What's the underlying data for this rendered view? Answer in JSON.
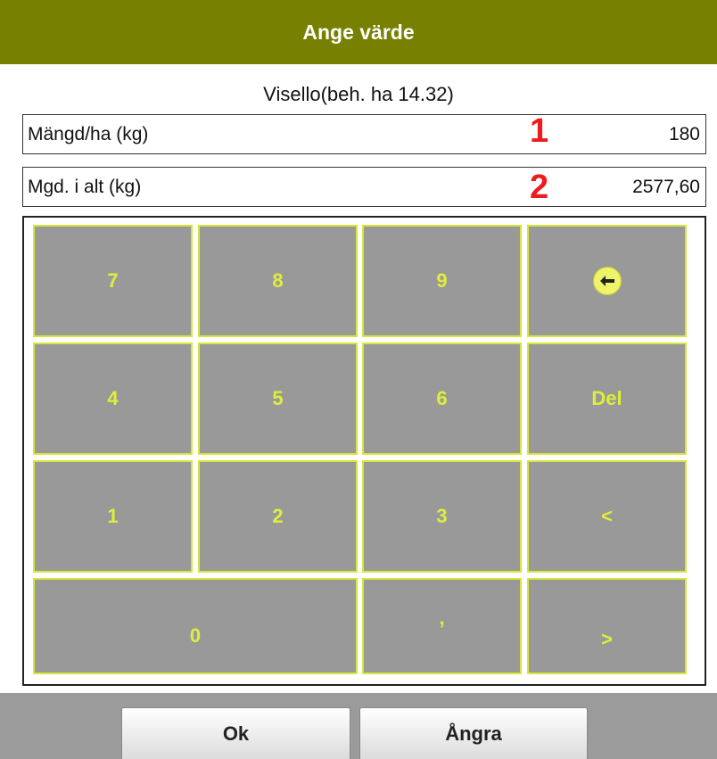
{
  "header": {
    "title": "Ange värde"
  },
  "subtitle": "Visello(beh. ha 14.32)",
  "fields": [
    {
      "label": "Mängd/ha (kg)",
      "value": "180",
      "marker": "1"
    },
    {
      "label": "Mgd. i alt (kg)",
      "value": "2577,60",
      "marker": "2"
    }
  ],
  "keypad": {
    "keys": [
      "7",
      "8",
      "9",
      "4",
      "5",
      "6",
      "Del",
      "1",
      "2",
      "3",
      "<",
      "0",
      ",",
      ">"
    ],
    "backspace_icon": "arrow-left-circle-icon"
  },
  "footer": {
    "ok_label": "Ok",
    "undo_label": "Ångra"
  },
  "colors": {
    "header_bg": "#778000",
    "key_bg": "#999999",
    "key_border": "#d8e63a",
    "key_text": "#dfee3a",
    "marker": "#ee1c1c",
    "footer_bg": "#9b9b9b"
  }
}
